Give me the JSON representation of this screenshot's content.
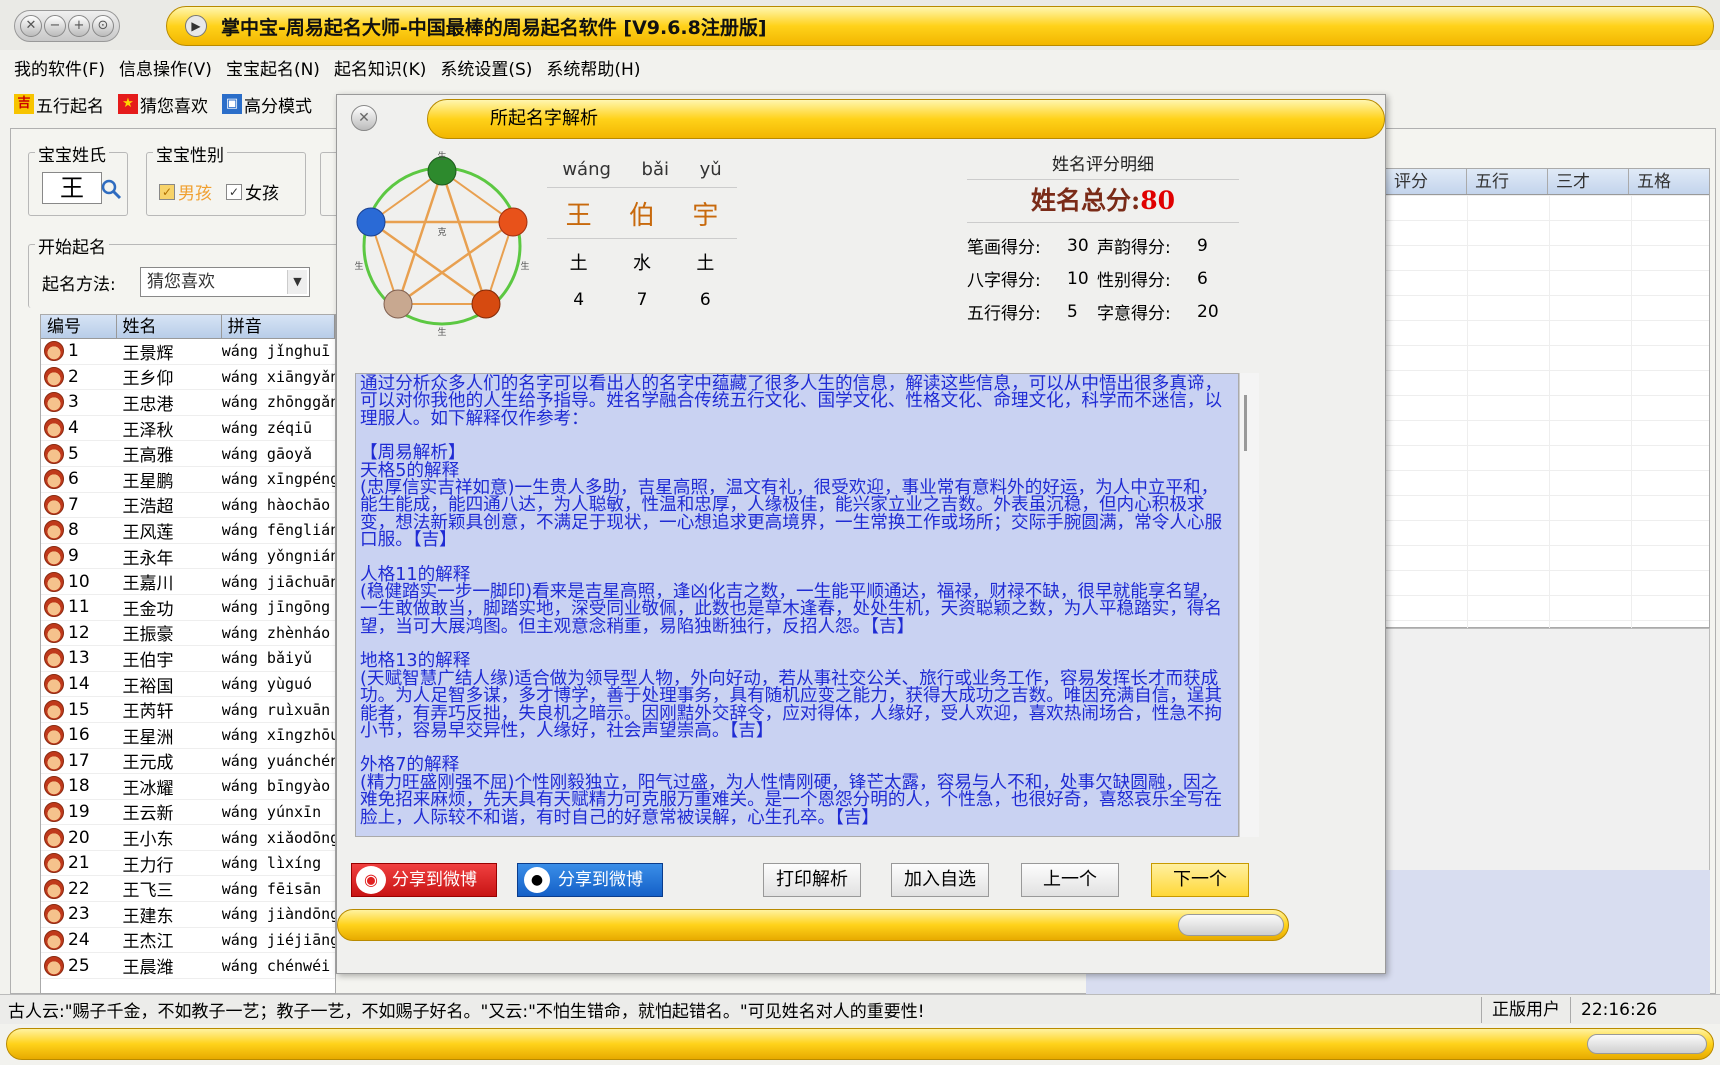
{
  "window": {
    "title": "掌中宝-周易起名大师-中国最棒的周易起名软件 [V9.6.8注册版]"
  },
  "menu": [
    "我的软件(F)",
    "信息操作(V)",
    "宝宝起名(N)",
    "起名知识(K)",
    "系统设置(S)",
    "系统帮助(H)"
  ],
  "toolbar": {
    "wuxing": "五行起名",
    "guess": "猜您喜欢",
    "highscore": "高分模式"
  },
  "surname": {
    "label": "宝宝姓氏",
    "value": "王"
  },
  "gender": {
    "label": "宝宝性别",
    "boy": "男孩",
    "girl": "女孩"
  },
  "start": {
    "label": "开始起名",
    "method_label": "起名方法:",
    "method_value": "猜您喜欢"
  },
  "list": {
    "headers": [
      "编号",
      "姓名",
      "拼音"
    ],
    "rows": [
      [
        "1",
        "王景辉",
        "wáng jǐnghuī"
      ],
      [
        "2",
        "王乡仰",
        "wáng xiāngyǎng"
      ],
      [
        "3",
        "王忠港",
        "wáng zhōnggǎng"
      ],
      [
        "4",
        "王泽秋",
        "wáng zéqiū"
      ],
      [
        "5",
        "王高雅",
        "wáng gāoyǎ"
      ],
      [
        "6",
        "王星鹏",
        "wáng xīngpéng"
      ],
      [
        "7",
        "王浩超",
        "wáng hàochāo"
      ],
      [
        "8",
        "王风莲",
        "wáng fēnglián"
      ],
      [
        "9",
        "王永年",
        "wáng yǒngnián"
      ],
      [
        "10",
        "王嘉川",
        "wáng jiāchuān"
      ],
      [
        "11",
        "王金功",
        "wáng jīngōng"
      ],
      [
        "12",
        "王振豪",
        "wáng zhènháo"
      ],
      [
        "13",
        "王伯宇",
        "wáng bǎiyǔ"
      ],
      [
        "14",
        "王裕国",
        "wáng yùguó"
      ],
      [
        "15",
        "王芮轩",
        "wáng ruìxuān"
      ],
      [
        "16",
        "王星洲",
        "wáng xīngzhōu"
      ],
      [
        "17",
        "王元成",
        "wáng yuánchéng"
      ],
      [
        "18",
        "王冰耀",
        "wáng bīngyào"
      ],
      [
        "19",
        "王云新",
        "wáng yúnxīn"
      ],
      [
        "20",
        "王小东",
        "wáng xiǎodōng"
      ],
      [
        "21",
        "王力行",
        "wáng lìxíng"
      ],
      [
        "22",
        "王飞三",
        "wáng fēisān"
      ],
      [
        "23",
        "王建东",
        "wáng jiàndōng"
      ],
      [
        "24",
        "王杰江",
        "wáng jiéjiāng"
      ],
      [
        "25",
        "王晨潍",
        "wáng chénwéi"
      ]
    ]
  },
  "right_table": {
    "headers": [
      "评分",
      "五行",
      "三才",
      "五格"
    ]
  },
  "dialog": {
    "title": "所起名字解析",
    "pinyin": [
      "wáng",
      "bǎi",
      "yǔ"
    ],
    "chars": [
      "王",
      "伯",
      "宇"
    ],
    "elements": [
      "土",
      "水",
      "土"
    ],
    "strokes": [
      "4",
      "7",
      "6"
    ],
    "score": {
      "title": "姓名评分明细",
      "total_label": "姓名总分:",
      "total_value": "80",
      "items": [
        {
          "label": "笔画得分:",
          "value": "30"
        },
        {
          "label": "声韵得分:",
          "value": "9"
        },
        {
          "label": "八字得分:",
          "value": "10"
        },
        {
          "label": "性别得分:",
          "value": "6"
        },
        {
          "label": "五行得分:",
          "value": "5"
        },
        {
          "label": "字意得分:",
          "value": "20"
        }
      ]
    },
    "analysis": [
      "通过分析众多人们的名字可以看出人的名字中蕴藏了很多人生的信息，解读这些信息，可以从中悟出很多真谛，可以对你我他的人生给予指导。姓名学融合传统五行文化、国学文化、性格文化、命理文化，科学而不迷信，以理服人。如下解释仅作参考：",
      "",
      "【周易解析】",
      "天格5的解释",
      "(忠厚信实吉祥如意)一生贵人多助，吉星高照，温文有礼，很受欢迎，事业常有意料外的好运，为人中立平和，能生能成，能四通八达，为人聪敏，性温和忠厚，人缘极佳，能兴家立业之吉数。外表虽沉稳，但内心积极求变，想法新颖具创意，不满足于现状，一心想追求更高境界，一生常换工作或场所；交际手腕圆满，常令人心服口服。【吉】",
      "",
      "人格11的解释",
      "(稳健踏实一步一脚印)看来是吉星高照，逢凶化吉之数，一生能平顺通达，福禄，财禄不缺，很早就能享名望，一生敢做敢当，脚踏实地，深受同业敬佩，此数也是草木逢春，处处生机，天资聪颖之数，为人平稳踏实，得名望，当可大展鸿图。但主观意念稍重，易陷独断独行，反招人怨。【吉】",
      "",
      "地格13的解释",
      "(天赋智慧广结人缘)适合做为领导型人物，外向好动，若从事社交公关、旅行或业务工作，容易发挥长才而获成功。为人足智多谋，多才博学，善于处理事务，具有随机应变之能力，获得大成功之吉数。唯因充满自信，逞其能者，有弄巧反拙，失良机之暗示。因刚黠外交辞令，应对得体，人缘好，受人欢迎，喜欢热闹场合，性急不拘小节，容易早交异性，人缘好，社会声望崇高。【吉】",
      "",
      "外格7的解释",
      "(精力旺盛刚强不屈)个性刚毅独立，阳气过盛，为人性情刚硬，锋芒太露，容易与人不和，处事欠缺圆融，因之难免招来麻烦，先天具有天赋精力可克服万重难关。是一个恩怨分明的人，个性急，也很好奇，喜怒哀乐全写在脸上，人际较不和谐，有时自己的好意常被误解，心生孔卒。【吉】"
    ],
    "buttons": {
      "share_weibo": "分享到微博",
      "share_qq": "分享到微博",
      "print": "打印解析",
      "add": "加入自选",
      "prev": "上一个",
      "next": "下一个"
    }
  },
  "status": {
    "message": "古人云:\"赐子千金，不如教子一艺；教子一艺，不如赐子好名。\"又云:\"不怕生错命，就怕起错名。\"可见姓名对人的重要性!",
    "user": "正版用户",
    "time": "22:16:26"
  },
  "colors": {
    "title_yellow": "#ffd21a",
    "analysis_bg": "#c9d2f2",
    "analysis_text": "#1f2bd4",
    "score_red": "#e00000"
  }
}
